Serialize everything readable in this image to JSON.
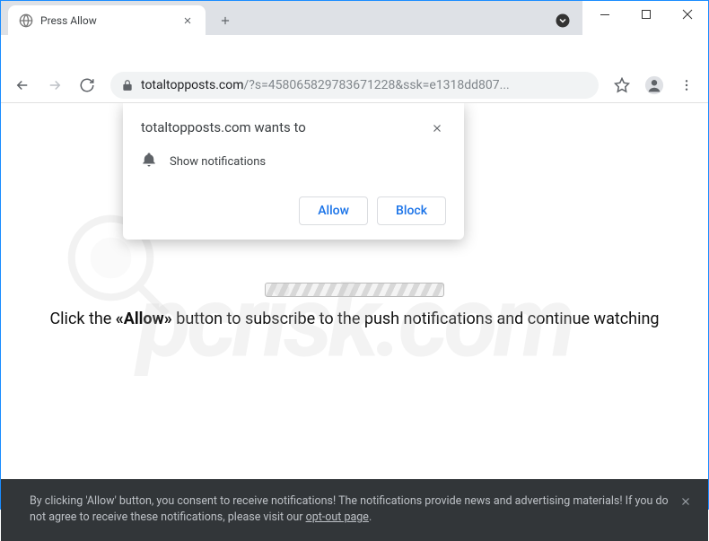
{
  "tab": {
    "title": "Press Allow"
  },
  "omnibox": {
    "domain": "totaltopposts.com",
    "path": "/?s=458065829783671228&ssk=e1318dd807..."
  },
  "notification_prompt": {
    "title": "totaltopposts.com wants to",
    "permission_label": "Show notifications",
    "allow_label": "Allow",
    "block_label": "Block"
  },
  "page": {
    "instruction_prefix": "Click the ",
    "instruction_bold": "«Allow»",
    "instruction_suffix": " button to subscribe to the push notifications and continue watching"
  },
  "consent_bar": {
    "text_part1": "By clicking 'Allow' button, you consent to receive notifications! The notifications provide news and advertising materials! If you do not agree to receive these notifications, please visit our ",
    "link_text": "opt-out page",
    "text_part2": "."
  },
  "watermark": {
    "text": "pcrisk.com"
  }
}
